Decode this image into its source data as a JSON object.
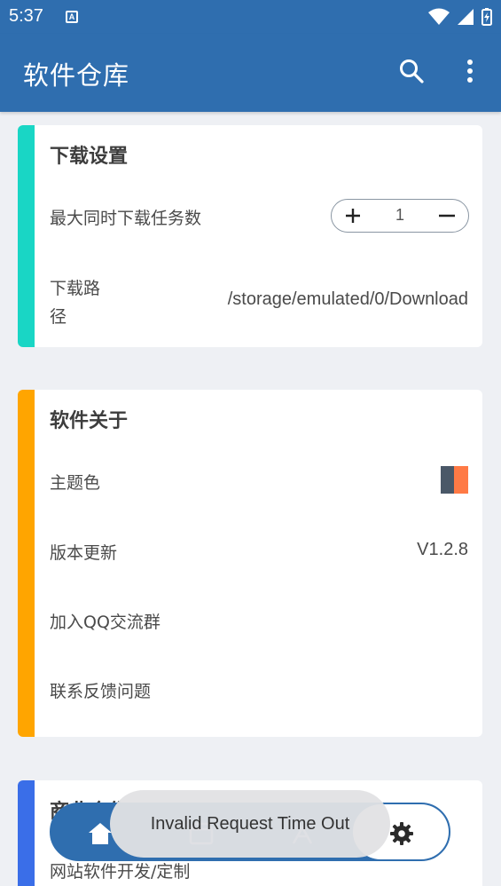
{
  "status": {
    "time": "5:37",
    "notif_letter": "A"
  },
  "appbar": {
    "title": "软件仓库"
  },
  "download_card": {
    "heading": "下载设置",
    "stripe_color": "#19d6c5",
    "max_downloads_label": "最大同时下载任务数",
    "max_downloads_value": "1",
    "path_label_line1": "下载路",
    "path_label_line2": "径",
    "path_value": "/storage/emulated/0/Download"
  },
  "about_card": {
    "heading": "软件关于",
    "stripe_color": "#ffa500",
    "theme_label": "主题色",
    "theme_colors": [
      "#4a5868",
      "#ff7a45"
    ],
    "update_label": "版本更新",
    "version": "V1.2.8",
    "join_group_label": "加入QQ交流群",
    "feedback_label": "联系反馈问题"
  },
  "business_card": {
    "stripe_color": "#3a6ee8",
    "heading": "商业合作",
    "item1": "网站软件开发/定制"
  },
  "toast": {
    "message": "Invalid Request Time Out"
  },
  "nav": {
    "accent": "#2f6eaf",
    "tabs": [
      "home-icon",
      "box-icon",
      "apps-icon",
      "settings-icon"
    ]
  }
}
